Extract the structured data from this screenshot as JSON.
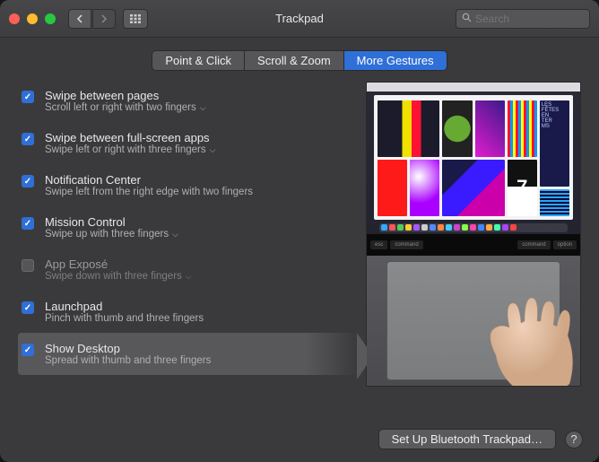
{
  "window": {
    "title": "Trackpad"
  },
  "search": {
    "placeholder": "Search"
  },
  "tabs": [
    {
      "label": "Point & Click",
      "active": false
    },
    {
      "label": "Scroll & Zoom",
      "active": false
    },
    {
      "label": "More Gestures",
      "active": true
    }
  ],
  "options": [
    {
      "id": "swipe-pages",
      "checked": true,
      "label": "Swipe between pages",
      "sub": "Scroll left or right with two fingers",
      "dropdown": true,
      "selected": false,
      "disabled": false
    },
    {
      "id": "swipe-apps",
      "checked": true,
      "label": "Swipe between full-screen apps",
      "sub": "Swipe left or right with three fingers",
      "dropdown": true,
      "selected": false,
      "disabled": false
    },
    {
      "id": "notification-center",
      "checked": true,
      "label": "Notification Center",
      "sub": "Swipe left from the right edge with two fingers",
      "dropdown": false,
      "selected": false,
      "disabled": false
    },
    {
      "id": "mission-control",
      "checked": true,
      "label": "Mission Control",
      "sub": "Swipe up with three fingers",
      "dropdown": true,
      "selected": false,
      "disabled": false
    },
    {
      "id": "app-expose",
      "checked": false,
      "label": "App Exposé",
      "sub": "Swipe down with three fingers",
      "dropdown": true,
      "selected": false,
      "disabled": true
    },
    {
      "id": "launchpad",
      "checked": true,
      "label": "Launchpad",
      "sub": "Pinch with thumb and three fingers",
      "dropdown": false,
      "selected": false,
      "disabled": false
    },
    {
      "id": "show-desktop",
      "checked": true,
      "label": "Show Desktop",
      "sub": "Spread with thumb and three fingers",
      "dropdown": false,
      "selected": true,
      "disabled": false
    }
  ],
  "touchbar": {
    "esc": "esc",
    "command_l": "command",
    "command_r": "command",
    "option": "option"
  },
  "footer": {
    "setup_label": "Set Up Bluetooth Trackpad…",
    "help_label": "?"
  },
  "preview_text": {
    "seven": "7",
    "fetes": "LES\nFÊTES\nEN\nTER\nMS"
  }
}
